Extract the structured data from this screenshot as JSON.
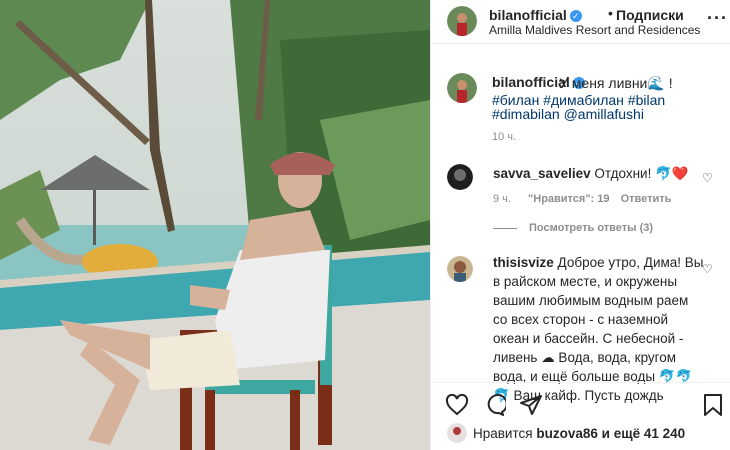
{
  "header": {
    "username": "bilanofficial",
    "follow": "Подписки",
    "location": "Amilla Maldives Resort and Residences",
    "more": "···"
  },
  "caption": {
    "username": "bilanofficial",
    "text": "У меня ливни🌊 !",
    "tags_line1": "#билан #димабилан #bilan",
    "tags_line2": "#dimabilan @amillafushi",
    "time": "10 ч."
  },
  "comments": [
    {
      "username": "savva_saveliev",
      "text": "Отдохни! 🐬❤️",
      "time": "9 ч.",
      "likes": "\"Нравится\": 19",
      "reply": "Ответить"
    }
  ],
  "replies_toggle": "Посмотреть ответы (3)",
  "comment2": {
    "username": "thisisvize",
    "text": "Доброе утро, Дима! Вы в райском месте, и окружены вашим любимым водным раем со всех сторон - с наземной океан и бассейн. С небесной - ливень ☁ Вода, вода, кругом вода, и ещё больше воды 🐬🐬 🐬 Ваш кайф. Пусть дождь"
  },
  "likes": {
    "prefix": "Нравится",
    "user": "buzova86",
    "suffix": "и ещё 41 240"
  },
  "colors": {
    "link": "#00376b",
    "verified": "#3897f0",
    "meta": "#8e8e8e",
    "heart": "#ed4956"
  }
}
